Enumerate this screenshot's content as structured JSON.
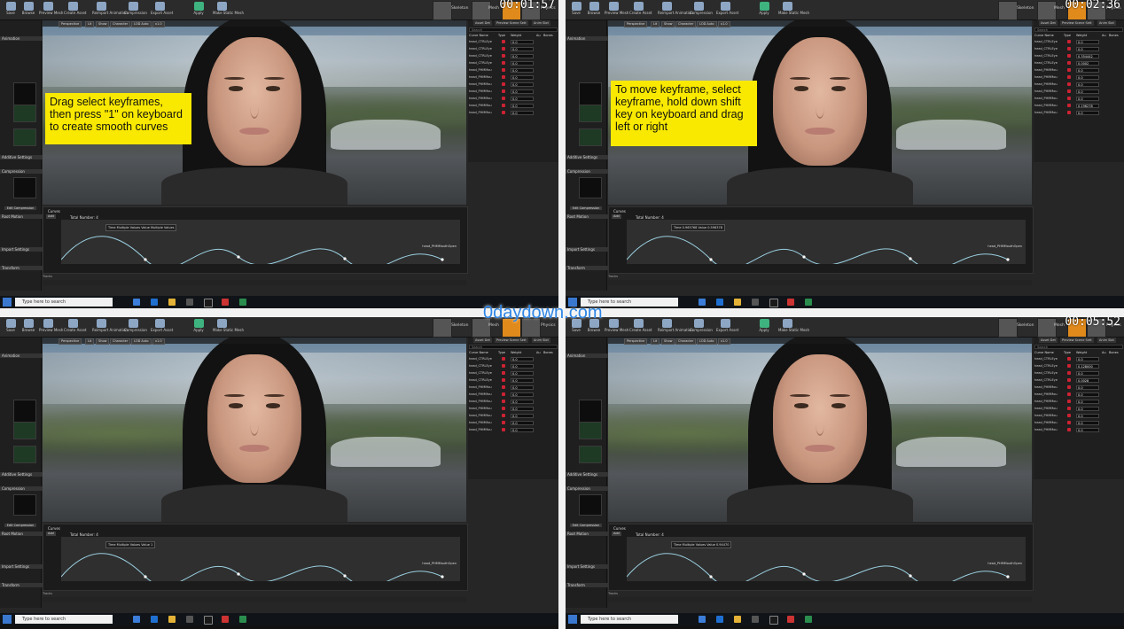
{
  "watermark": "0daydown.com",
  "toolbar": [
    "Save",
    "Browse",
    "Preview Mesh",
    "Create Asset",
    "Reimport Animation",
    "Compression",
    "Export Asset",
    "Apply",
    "Make Static Mesh"
  ],
  "modes": [
    "Skeleton",
    "Mesh",
    "Animation",
    "Physics"
  ],
  "viewport_buttons": [
    "Perspective",
    "Lit",
    "Show",
    "Character",
    "LOD Auto",
    "x1.0"
  ],
  "left_sections": [
    "Animation",
    "Additive Settings",
    "Compression",
    "Root Motion",
    "Import Settings",
    "Transform"
  ],
  "edit_compression": "Edit Compression",
  "right_tabs": [
    "Asset Det",
    "Preview Scene Sett",
    "Anim Slot"
  ],
  "search_placeholder": "Search",
  "curve_headers": {
    "name": "Curve Name",
    "type": "Type",
    "weight": "Weight",
    "au": "Au",
    "bones": "Bones"
  },
  "curve_names": [
    "head_CTRLEye",
    "head_CTRLEye",
    "head_CTRLEye",
    "head_CTRLEye",
    "head_PHMMou",
    "head_PHMMou",
    "head_PHMMou",
    "head_PHMMou",
    "head_PHMMou",
    "head_PHMMou",
    "head_PHMMou"
  ],
  "curve_editor": {
    "add": "Add",
    "total_number": "Total Number: 4",
    "section": "Curves",
    "curve_label": "head_PHMMouthOpen",
    "tracks": "Tracks"
  },
  "taskbar": {
    "search": "Type here to search"
  },
  "quads": [
    {
      "timestamp": "00:01:57",
      "callout": "Drag select keyframes, then press \"1\" on keyboard to create smooth curves",
      "value_box": "Time  Multiple Values  Value  Multiple Values",
      "weights": [
        "0.0",
        "0.0",
        "0.0",
        "0.0",
        "0.0",
        "0.0",
        "0.0",
        "0.0",
        "0.0",
        "0.0",
        "0.0"
      ]
    },
    {
      "timestamp": "00:02:36",
      "callout": "To move keyframe, select keyframe, hold down shift key on keyboard and drag left or right",
      "value_box": "Time  0.965768  Value  0.596378",
      "weights": [
        "0.0",
        "0.0",
        "0.354442",
        "0.0002",
        "0.0",
        "0.0",
        "0.0",
        "0.0",
        "0.0",
        "0.196278",
        "0.0"
      ]
    },
    {
      "timestamp": "",
      "callout": "",
      "value_box": "Time  Multiple Values  Value  1",
      "weights": [
        "0.0",
        "0.0",
        "0.0",
        "0.0",
        "0.0",
        "0.0",
        "0.0",
        "0.0",
        "0.0",
        "0.0",
        "0.0"
      ]
    },
    {
      "timestamp": "00:05:52",
      "callout": "",
      "value_box": "Time  Multiple Values  Value  0.94470",
      "weights": [
        "0.0",
        "0.128000",
        "0.0",
        "0.0028",
        "0.0",
        "0.0",
        "0.0",
        "0.0",
        "0.0",
        "0.0",
        "0.0"
      ]
    }
  ]
}
